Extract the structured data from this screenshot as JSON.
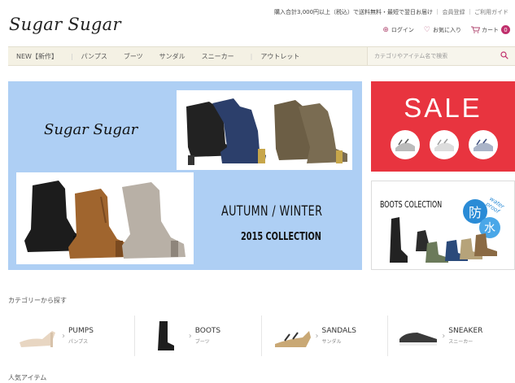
{
  "header": {
    "logo": "Sugar Sugar",
    "notice": "購入合計3,000円以上（税込）で送料無料・最短で翌日お届け",
    "links": [
      "会員登録",
      "ご利用ガイド"
    ],
    "login": "ログイン",
    "favorites": "お気に入り",
    "cart": "カート",
    "cart_count": "0"
  },
  "nav": {
    "items": [
      "NEW【新作】",
      "パンプス",
      "ブーツ",
      "サンダル",
      "スニーカー",
      "アウトレット"
    ],
    "search_placeholder": "カテゴリやアイテム名で検索"
  },
  "hero": {
    "brand": "Sugar Sugar",
    "season": "AUTUMN  /  WINTER",
    "collection": "2015  COLLECTION"
  },
  "sale_banner": {
    "text": "SALE"
  },
  "boots_banner": {
    "title": "BOOTS COLECTION",
    "kanji1": "防",
    "kanji2": "水",
    "waterproof": "water proof"
  },
  "categories": {
    "title": "カテゴリーから探す",
    "items": [
      {
        "en": "PUMPS",
        "jp": "パンプス"
      },
      {
        "en": "BOOTS",
        "jp": "ブーツ"
      },
      {
        "en": "SANDALS",
        "jp": "サンダル"
      },
      {
        "en": "SNEAKER",
        "jp": "スニーカー"
      }
    ]
  },
  "popular": {
    "title": "人気アイテム"
  },
  "colors": {
    "accent": "#c02f6c",
    "sale_red": "#e8343f",
    "hero_blue": "#aecff4",
    "nav_bg": "#f4f1e4"
  }
}
